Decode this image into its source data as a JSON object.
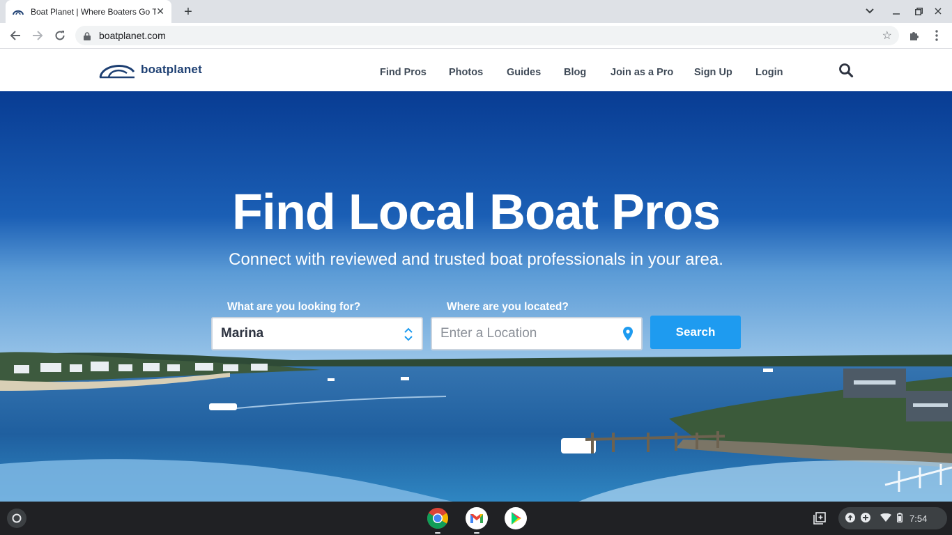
{
  "browser": {
    "tab_title": "Boat Planet | Where Boaters Go T",
    "url": "boatplanet.com"
  },
  "site": {
    "logo_text": "boatplanet",
    "nav": [
      "Find Pros",
      "Photos",
      "Guides",
      "Blog",
      "Join as a Pro",
      "Sign Up",
      "Login"
    ]
  },
  "hero": {
    "title": "Find Local Boat Pros",
    "subtitle": "Connect with reviewed and trusted boat professionals in your area.",
    "looking_for_label": "What are you looking for?",
    "looking_for_value": "Marina",
    "location_label": "Where are you located?",
    "location_placeholder": "Enter a Location",
    "search_label": "Search"
  },
  "taskbar": {
    "time": "7:54",
    "apps": [
      "chrome-icon",
      "gmail-icon",
      "play-store-icon"
    ]
  },
  "colors": {
    "brand_navy": "#1d3f72",
    "search_button": "#1e9bf0",
    "hero_blue": "#0a3f96"
  }
}
